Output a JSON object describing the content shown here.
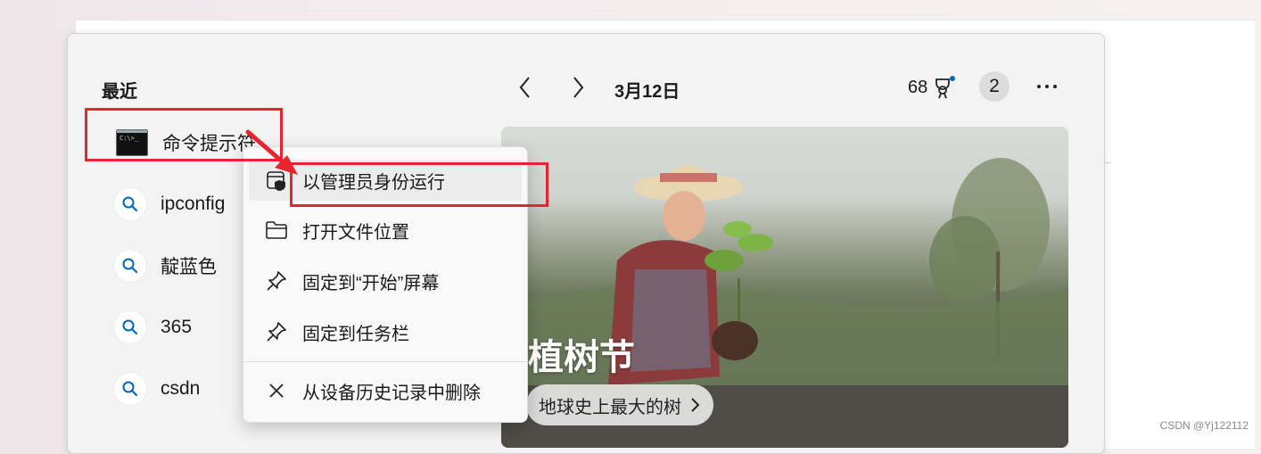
{
  "recent": {
    "title": "最近",
    "items": [
      {
        "label": "命令提示符",
        "icon": "terminal-icon"
      },
      {
        "label": "ipconfig",
        "icon": "search-icon"
      },
      {
        "label": "靛蓝色",
        "icon": "search-icon"
      },
      {
        "label": "365",
        "icon": "search-icon"
      },
      {
        "label": "csdn",
        "icon": "search-icon"
      }
    ]
  },
  "header": {
    "date": "3月12日",
    "points": "68",
    "badge_count": "2"
  },
  "banner": {
    "title": "植树节",
    "chip_label": "地球史上最大的树"
  },
  "context_menu": {
    "items": [
      {
        "label": "以管理员身份运行",
        "icon": "admin-shield-icon"
      },
      {
        "label": "打开文件位置",
        "icon": "folder-icon"
      },
      {
        "label": "固定到“开始”屏幕",
        "icon": "pin-icon"
      },
      {
        "label": "固定到任务栏",
        "icon": "pin-icon"
      },
      {
        "label": "从设备历史记录中删除",
        "icon": "close-icon"
      }
    ]
  },
  "watermark": "CSDN @Yj122112",
  "colors": {
    "annotation_red": "#e8252e",
    "accent": "#0067c0"
  }
}
